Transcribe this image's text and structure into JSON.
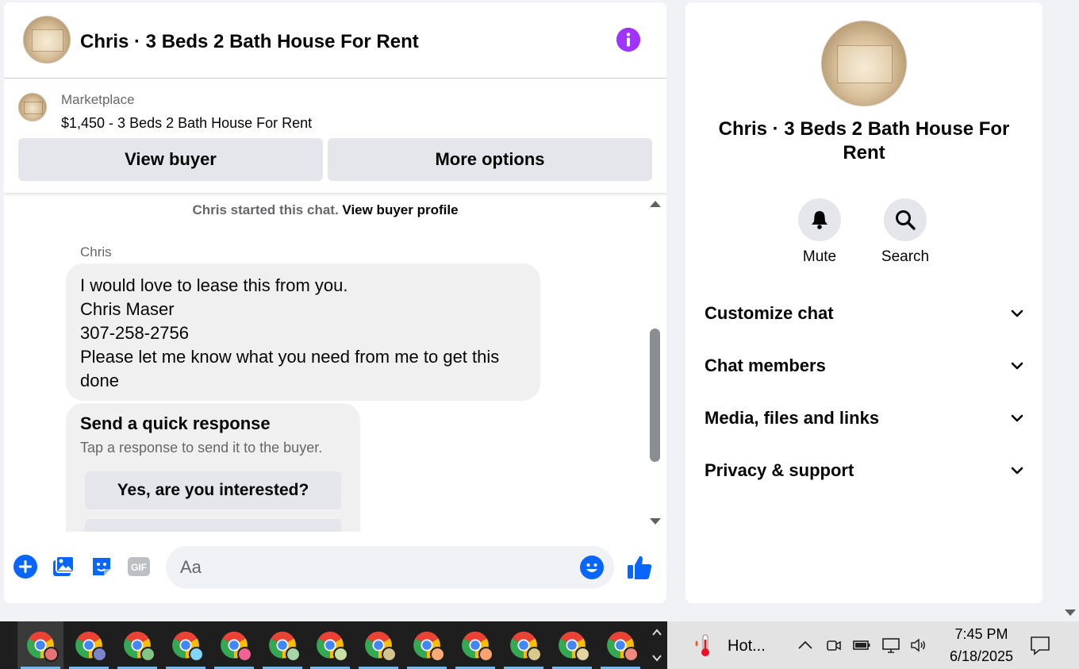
{
  "chat_header": {
    "title": "Chris · 3 Beds 2 Bath House For Rent",
    "info_icon": "info-icon",
    "accent_color": "#a033ff"
  },
  "marketplace": {
    "label": "Marketplace",
    "listing": "$1,450 - 3 Beds 2 Bath House For Rent",
    "view_buyer_label": "View buyer",
    "more_options_label": "More options"
  },
  "messages": {
    "started_text": "Chris started this chat.",
    "view_profile_link": "View buyer profile",
    "sender": "Chris",
    "message_lines": [
      "I would love to lease this from you.",
      "Chris Maser",
      "307-258-2756",
      "Please let me know what you need from me to get this",
      "done"
    ]
  },
  "quick_response": {
    "title": "Send a quick response",
    "subtitle": "Tap a response to send it to the buyer.",
    "options": [
      "Yes, are you interested?"
    ]
  },
  "composer": {
    "placeholder": "Aa",
    "icons": [
      "plus-icon",
      "photo-icon",
      "sticker-icon",
      "gif-icon",
      "emoji-icon",
      "like-icon"
    ],
    "brand_color": "#0866ff"
  },
  "info_panel": {
    "title": "Chris · 3 Beds 2 Bath House For Rent",
    "actions": [
      {
        "label": "Mute",
        "icon": "bell-icon"
      },
      {
        "label": "Search",
        "icon": "search-icon"
      }
    ],
    "sections": [
      "Customize chat",
      "Chat members",
      "Media, files and links",
      "Privacy & support"
    ]
  },
  "taskbar": {
    "app_count": 13,
    "weather_text": "Hot...",
    "time": "7:45 PM",
    "date": "6/18/2025",
    "tray_icons": [
      "chevron-up-icon",
      "meet-icon",
      "battery-icon",
      "network-icon",
      "volume-icon",
      "notification-icon"
    ]
  }
}
